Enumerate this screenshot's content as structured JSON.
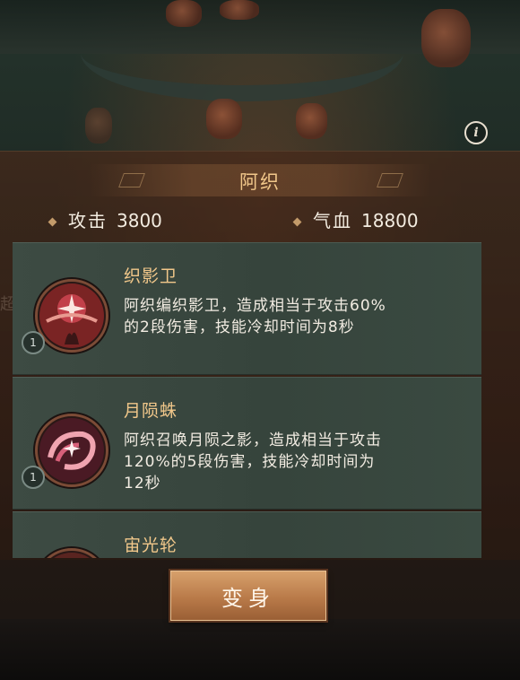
{
  "header": {
    "info_icon": "info-icon"
  },
  "character": {
    "name": "阿织",
    "stats": [
      {
        "label": "攻击",
        "value": "3800"
      },
      {
        "label": "气血",
        "value": "18800"
      }
    ]
  },
  "skills": [
    {
      "name": "织影卫",
      "desc": "阿织编织影卫，造成相当于攻击60%的2段伤害，技能冷却时间为8秒",
      "level": "1",
      "icon": "star-burst-skill-icon"
    },
    {
      "name": "月陨蛛",
      "desc": "阿织召唤月陨之影，造成相当于攻击120%的5段伤害，技能冷却时间为12秒",
      "level": "1",
      "icon": "spiral-moon-skill-icon"
    },
    {
      "name": "宙光轮",
      "desc": "",
      "level": "",
      "icon": "wheel-skill-icon"
    }
  ],
  "actions": {
    "transform_label": "变身"
  },
  "background": {
    "side_text": "超"
  },
  "colors": {
    "gold_text": "#f1c78a",
    "button": "#b97a49",
    "card": "#3d4b43"
  }
}
